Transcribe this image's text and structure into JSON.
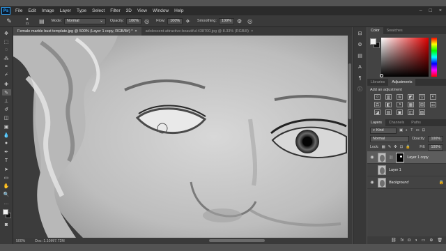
{
  "menu": {
    "logo": "Ps",
    "items": [
      "File",
      "Edit",
      "Image",
      "Layer",
      "Type",
      "Select",
      "Filter",
      "3D",
      "View",
      "Window",
      "Help"
    ],
    "window_controls": [
      "–",
      "□",
      "×"
    ]
  },
  "options": {
    "mode_label": "Mode:",
    "mode_value": "Normal",
    "opacity_label": "Opacity:",
    "opacity_value": "100%",
    "flow_label": "Flow:",
    "flow_value": "100%",
    "smoothing_label": "Smoothing:",
    "smoothing_value": "100%",
    "brush_size": "11"
  },
  "tabs": [
    {
      "label": "Female marble bust template.jpg @ 500% (Layer 1 copy, RGB/8#) *",
      "close": "×"
    },
    {
      "label": "adolescent-attractive-beautiful-438700.jpg @ 8.33% (RGB/8)",
      "close": "×"
    }
  ],
  "status": {
    "zoom": "500%",
    "doc": "Doc: 1.10M/7.72M"
  },
  "color_panel": {
    "tabs": [
      "Color",
      "Swatches"
    ],
    "foreground": "#f2f2f2",
    "background": "#111111"
  },
  "adjust_panel": {
    "tabs": [
      "Libraries",
      "Adjustments"
    ],
    "add_label": "Add an adjustment",
    "icons": [
      "☼",
      "▥",
      "≋",
      "◩",
      "▽",
      "◐",
      "⚖",
      "◧",
      "◑",
      "▦",
      "⊞",
      "☷",
      "◪",
      "▤",
      "▣",
      "◫",
      "▨"
    ]
  },
  "layers_panel": {
    "tabs": [
      "Layers",
      "Channels",
      "Paths"
    ],
    "kind_label": "Kind",
    "blend_mode": "Normal",
    "opacity_label": "Opacity:",
    "opacity_value": "100%",
    "lock_label": "Lock:",
    "fill_label": "Fill:",
    "fill_value": "100%",
    "layers": [
      {
        "name": "Layer 1 copy",
        "selected": true
      },
      {
        "name": "Layer 1",
        "selected": false
      },
      {
        "name": "Background",
        "selected": false
      }
    ],
    "footer_icons": [
      "⛓",
      "fx",
      "◘",
      "◑",
      "▭",
      "⊕",
      "🗑"
    ]
  }
}
